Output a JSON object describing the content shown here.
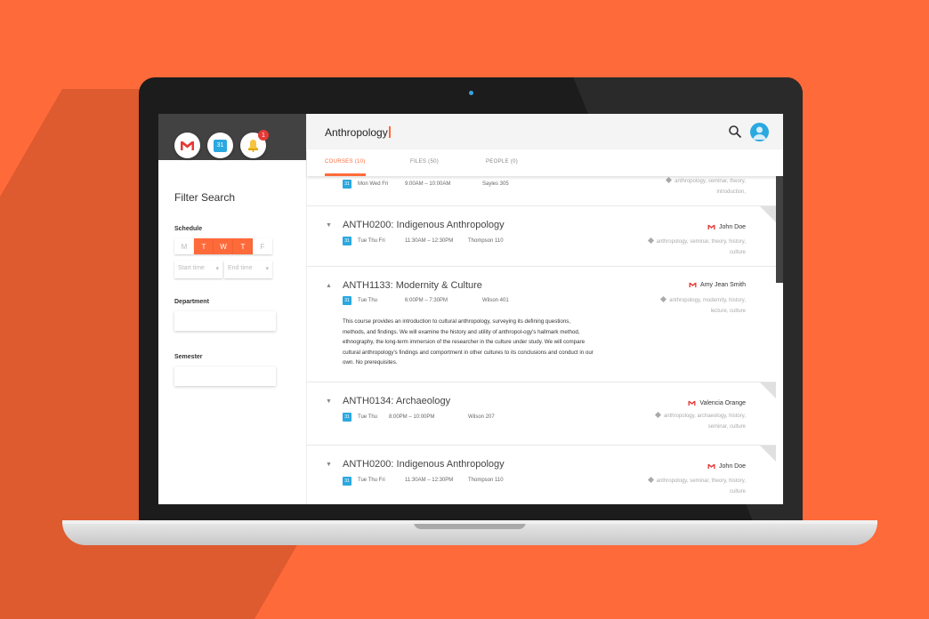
{
  "sidebar": {
    "apps": [
      {
        "name": "gmail",
        "label": "M"
      },
      {
        "name": "calendar",
        "label": "31"
      },
      {
        "name": "notifications",
        "badge": "1"
      }
    ],
    "filter_title": "Filter Search",
    "schedule_label": "Schedule",
    "days": [
      "M",
      "T",
      "W",
      "T",
      "F"
    ],
    "active_days": [
      "T",
      "W",
      "T"
    ],
    "start_time_placeholder": "Start time",
    "end_time_placeholder": "End time",
    "department_label": "Department",
    "semester_label": "Semester"
  },
  "search": {
    "query": "Anthropology"
  },
  "tabs": [
    {
      "label": "COURSES (10)",
      "active": true
    },
    {
      "label": "FILES (50)",
      "active": false
    },
    {
      "label": "PEOPLE (0)",
      "active": false
    }
  ],
  "courses": [
    {
      "title": "",
      "calendar": "31",
      "days": "Mon Wed Fri",
      "time": "9:00AM – 10:00AM",
      "room": "Sayles 305",
      "instructor": "",
      "tags": "anthropology, seminar, theory, introduction,"
    },
    {
      "title": "ANTH0200: Indigenous Anthropology",
      "calendar": "31",
      "days": "Tue Thu Fri",
      "time": "11:30AM – 12:30PM",
      "room": "Thompson 110",
      "instructor": "John Doe",
      "tags": "anthropology, seminar, theory, history, culture"
    },
    {
      "title": "ANTH1133: Modernity & Culture",
      "calendar": "31",
      "days": "Tue Thu",
      "time": "6:00PM – 7:30PM",
      "room": "Wilson 401",
      "instructor": "Amy Jean Smith",
      "tags": "anthropology, modernity, history, lecture, culture",
      "description": "This course provides an introduction to cultural anthropology, surveying its defining questions, methods, and findings. We will examine the history and utility of anthropol-ogy's hallmark method, ethnography, the long-term immersion of the researcher in the culture under study.  We will compare cultural anthropology's findings and comportment in other cultures to its conclusions and conduct in our own. No prerequisites."
    },
    {
      "title": "ANTH0134: Archaeology",
      "calendar": "31",
      "days": "Tue Thu",
      "time": "8:00PM – 10:00PM",
      "room": "Wilson 207",
      "instructor": "Valencia Orange",
      "tags": "anthropology, archaeology, history, seminar, culture"
    },
    {
      "title": "ANTH0200: Indigenous Anthropology",
      "calendar": "31",
      "days": "Tue Thu Fri",
      "time": "11:30AM – 12:30PM",
      "room": "Thompson 110",
      "instructor": "John Doe",
      "tags": "anthropology, seminar, theory, history, culture"
    }
  ],
  "colors": {
    "accent": "#ff6a3a",
    "calendar_blue": "#2aa8e0",
    "header_dark": "#424242"
  }
}
